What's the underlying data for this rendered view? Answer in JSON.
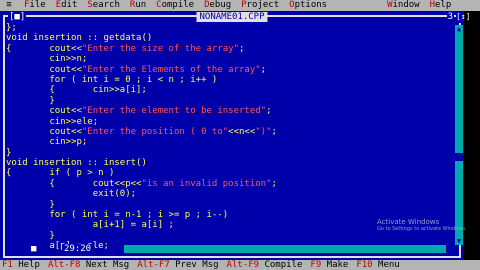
{
  "menubar": {
    "system": "≡",
    "items": [
      {
        "hotkey": "F",
        "rest": "ile"
      },
      {
        "hotkey": "E",
        "rest": "dit"
      },
      {
        "hotkey": "S",
        "rest": "earch"
      },
      {
        "hotkey": "R",
        "rest": "un"
      },
      {
        "hotkey": "C",
        "rest": "ompile"
      },
      {
        "hotkey": "D",
        "rest": "ebug"
      },
      {
        "hotkey": "P",
        "rest": "roject"
      },
      {
        "hotkey": "O",
        "rest": "ptions"
      },
      {
        "hotkey": "W",
        "rest": "indow"
      },
      {
        "hotkey": "H",
        "rest": "elp"
      }
    ]
  },
  "editor": {
    "close_glyph": "[■]",
    "title": "NONAME01.CPP",
    "window_number": "3",
    "resize_glyph": "[↕]",
    "cursor_position": "29:20",
    "modified_mark": "■",
    "lines": [
      [
        {
          "t": "};",
          "c": "n"
        }
      ],
      [
        {
          "t": "void insertion :: getdata()",
          "c": "n"
        }
      ],
      [
        {
          "t": "{       cout<<",
          "c": "n"
        },
        {
          "t": "\"Enter the size of the array\"",
          "c": "s"
        },
        {
          "t": ";",
          "c": "n"
        }
      ],
      [
        {
          "t": "        cin>>n;",
          "c": "n"
        }
      ],
      [
        {
          "t": "        cout<<",
          "c": "n"
        },
        {
          "t": "\"Enter the Elements of the array\"",
          "c": "s"
        },
        {
          "t": ";",
          "c": "n"
        }
      ],
      [
        {
          "t": "        for ( int i = 0 ; i < n ; i++ )",
          "c": "n"
        }
      ],
      [
        {
          "t": "        {       cin>>a[i];",
          "c": "n"
        }
      ],
      [
        {
          "t": "        }",
          "c": "n"
        }
      ],
      [
        {
          "t": "        cout<<",
          "c": "n"
        },
        {
          "t": "\"Enter the element to be inserted\"",
          "c": "s"
        },
        {
          "t": ";",
          "c": "n"
        }
      ],
      [
        {
          "t": "        cin>>ele;",
          "c": "n"
        }
      ],
      [
        {
          "t": "        cout<<",
          "c": "n"
        },
        {
          "t": "\"Enter the position ( 0 to\"",
          "c": "s"
        },
        {
          "t": "<<n<<",
          "c": "n"
        },
        {
          "t": "\")\"",
          "c": "s"
        },
        {
          "t": ";",
          "c": "n"
        }
      ],
      [
        {
          "t": "        cin>>p;",
          "c": "n"
        }
      ],
      [
        {
          "t": "}",
          "c": "n"
        }
      ],
      [
        {
          "t": "void insertion :: insert()",
          "c": "n"
        }
      ],
      [
        {
          "t": "{       if ( p > n )",
          "c": "n"
        }
      ],
      [
        {
          "t": "        {       cout<<p<<",
          "c": "n"
        },
        {
          "t": "\"is an invalid position\"",
          "c": "s"
        },
        {
          "t": ";",
          "c": "n"
        }
      ],
      [
        {
          "t": "                exit(0);",
          "c": "n"
        }
      ],
      [
        {
          "t": "        }",
          "c": "n"
        }
      ],
      [
        {
          "t": "        for ( int i = n-1 ; i >= p ; i--)",
          "c": "n"
        }
      ],
      [
        {
          "t": "                a[i+1] = a[i] ;",
          "c": "n"
        }
      ],
      [
        {
          "t": "        }",
          "c": "n"
        }
      ],
      [
        {
          "t": "        a[p] = ele;",
          "c": "n"
        }
      ]
    ]
  },
  "watermark": {
    "title": "Activate Windows",
    "subtitle": "Go to Settings to activate Windows."
  },
  "statusbar": {
    "items": [
      {
        "key": "F1",
        "label": " Help"
      },
      {
        "key": "Alt-F8",
        "label": " Next Msg"
      },
      {
        "key": "Alt-F7",
        "label": " Prev Msg"
      },
      {
        "key": "Alt-F9",
        "label": " Compile"
      },
      {
        "key": "F9",
        "label": " Make"
      },
      {
        "key": "F10",
        "label": " Menu"
      }
    ]
  },
  "colors": {
    "editor_bg": "#0000aa",
    "code_text": "#ffff55",
    "string_literal": "#ff5555",
    "menubar_bg": "#b4b4b4",
    "hotkey": "#c00000",
    "scrollbar": "#00aaaa"
  }
}
